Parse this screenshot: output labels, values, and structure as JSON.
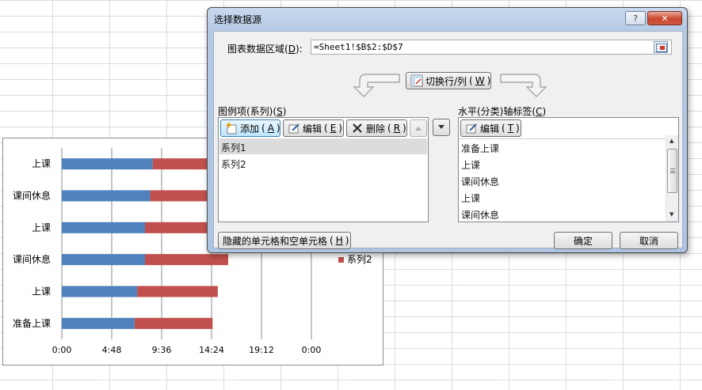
{
  "chart_data": {
    "type": "bar",
    "orientation": "horizontal",
    "stacked": true,
    "categories": [
      "准备上课",
      "上课",
      "课间休息",
      "上课",
      "课间休息",
      "上课"
    ],
    "series": [
      {
        "name": "系列1",
        "color": "#4f81bd",
        "values": [
          0.2917,
          0.3021,
          0.3333,
          0.3333,
          0.3542,
          0.3646
        ]
      },
      {
        "name": "系列2",
        "color": "#c0504d",
        "values": [
          0.3125,
          0.3229,
          0.3333,
          0.3333,
          0.3333,
          0.3333
        ]
      }
    ],
    "xtick_labels": [
      "0:00",
      "4:48",
      "9:36",
      "14:24",
      "19:12",
      "0:00"
    ],
    "xlim": [
      0,
      1
    ],
    "x_format": "time",
    "legend_visible": [
      "系列2"
    ],
    "legend_placement": "right",
    "grid": "vertical"
  },
  "dialog": {
    "title": "选择数据源",
    "help_label": "?",
    "close_label": "✕",
    "range_label_pre": "图表数据区域",
    "range_label_key": "D",
    "range_value": "=Sheet1!$B$2:$D$7",
    "switch_label": "切换行/列",
    "switch_key": "W",
    "series_header": "图例项(系列)",
    "series_header_key": "S",
    "axis_header": "水平(分类)轴标签",
    "axis_header_key": "C",
    "add_label": "添加",
    "add_key": "A",
    "edit_label": "编辑",
    "edit_key": "E",
    "delete_label": "删除",
    "delete_key": "R",
    "axis_edit_label": "编辑",
    "axis_edit_key": "T",
    "series_items": [
      "系列1",
      "系列2"
    ],
    "axis_items": [
      "准备上课",
      "上课",
      "课间休息",
      "上课",
      "课间休息"
    ],
    "hidden_cells_label": "隐藏的单元格和空单元格",
    "hidden_cells_key": "H",
    "ok_label": "确定",
    "cancel_label": "取消"
  }
}
